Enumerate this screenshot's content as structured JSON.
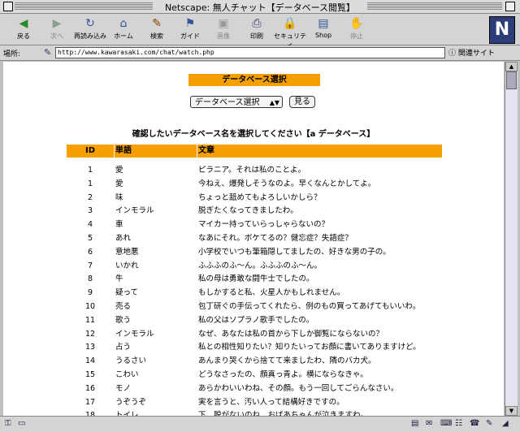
{
  "window": {
    "title": "Netscape: 無人チャット【データベース閲覧】"
  },
  "toolbar": [
    {
      "label": "戻る",
      "icon": "back-arrow-icon",
      "glyph": "◀",
      "color": "#2a8a2a",
      "enabled": true
    },
    {
      "label": "次へ",
      "icon": "forward-arrow-icon",
      "glyph": "▶",
      "color": "#8aa08a",
      "enabled": false
    },
    {
      "label": "再読み込み",
      "icon": "reload-icon",
      "glyph": "↻",
      "color": "#335599",
      "enabled": true
    },
    {
      "label": "ホーム",
      "icon": "home-icon",
      "glyph": "⌂",
      "color": "#335599",
      "enabled": true
    },
    {
      "label": "検索",
      "icon": "search-icon",
      "glyph": "✎",
      "color": "#884400",
      "enabled": true
    },
    {
      "label": "ガイド",
      "icon": "guide-icon",
      "glyph": "⚑",
      "color": "#335599",
      "enabled": true
    },
    {
      "label": "画像",
      "icon": "images-icon",
      "glyph": "▣",
      "color": "#999999",
      "enabled": false
    },
    {
      "label": "印刷",
      "icon": "print-icon",
      "glyph": "⎙",
      "color": "#333366",
      "enabled": true
    },
    {
      "label": "セキュリティ",
      "icon": "security-lock-icon",
      "glyph": "🔒",
      "color": "#886600",
      "enabled": true
    },
    {
      "label": "Shop",
      "icon": "shop-icon",
      "glyph": "▤",
      "color": "#335599",
      "enabled": true
    },
    {
      "label": "停止",
      "icon": "stop-icon",
      "glyph": "✋",
      "color": "#aaaaaa",
      "enabled": false
    }
  ],
  "logo": "N",
  "location": {
    "label": "場所:",
    "url": "http://www.kawarasaki.com/chat/watch.php",
    "related": "関連サイト"
  },
  "page": {
    "heading": "データベース選択",
    "select_value": "データベース選択",
    "go_button": "見る",
    "prompt": "確認したいデータベース名を選択してください【a データベース】",
    "table": {
      "headers": [
        "ID",
        "単語",
        "文章"
      ],
      "rows": [
        {
          "id": "1",
          "word": "愛",
          "text": "ピラニア。それは私のことよ。"
        },
        {
          "id": "1",
          "word": "愛",
          "text": "今ねえ、爆発しそうなのよ。早くなんとかしてよ。"
        },
        {
          "id": "2",
          "word": "味",
          "text": "ちょっと舐めてもよろしいかしら？"
        },
        {
          "id": "3",
          "word": "インモラル",
          "text": "脱ぎたくなってきましたわ。"
        },
        {
          "id": "4",
          "word": "車",
          "text": "マイカー持っていらっしゃらないの？"
        },
        {
          "id": "5",
          "word": "あれ",
          "text": "なあにそれ。ボケてるの？健忘症？失語症？"
        },
        {
          "id": "6",
          "word": "意地悪",
          "text": "小学校でいつも筆箱隠してましたの、好きな男の子の。"
        },
        {
          "id": "7",
          "word": "いかれ",
          "text": "ふふふのふ〜ん。ふふふのふ〜ん。"
        },
        {
          "id": "8",
          "word": "牛",
          "text": "私の母は勇敢な闘牛士でしたの。"
        },
        {
          "id": "9",
          "word": "疑って",
          "text": "もしかすると私、火星人かもしれません。"
        },
        {
          "id": "10",
          "word": "売る",
          "text": "包丁研ぐの手伝ってくれたら、例のもの買ってあげてもいいわ。"
        },
        {
          "id": "11",
          "word": "歌う",
          "text": "私の父はソプラノ歌手でしたの。"
        },
        {
          "id": "12",
          "word": "インモラル",
          "text": "なぜ、あなたは私の首から下しか御覧にならないの？"
        },
        {
          "id": "13",
          "word": "占う",
          "text": "私との相性知りたい？知りたいってお顔に書いてありますけど。"
        },
        {
          "id": "14",
          "word": "うるさい",
          "text": "あんまり哭くから捨てて来ましたわ、隣のバカ犬。"
        },
        {
          "id": "15",
          "word": "こわい",
          "text": "どうなさったの、顔真っ青よ。横にならなきゃ。"
        },
        {
          "id": "16",
          "word": "モノ",
          "text": "あらかわいいわね、その顔。もう一回してごらんなさい。"
        },
        {
          "id": "17",
          "word": "うぞうぞ",
          "text": "実を言うと、汚い人って結構好きですの。"
        },
        {
          "id": "18",
          "word": "トイレ",
          "text": "下、脱がないのね、おばあちゃんが泣きますわ。"
        }
      ]
    }
  }
}
